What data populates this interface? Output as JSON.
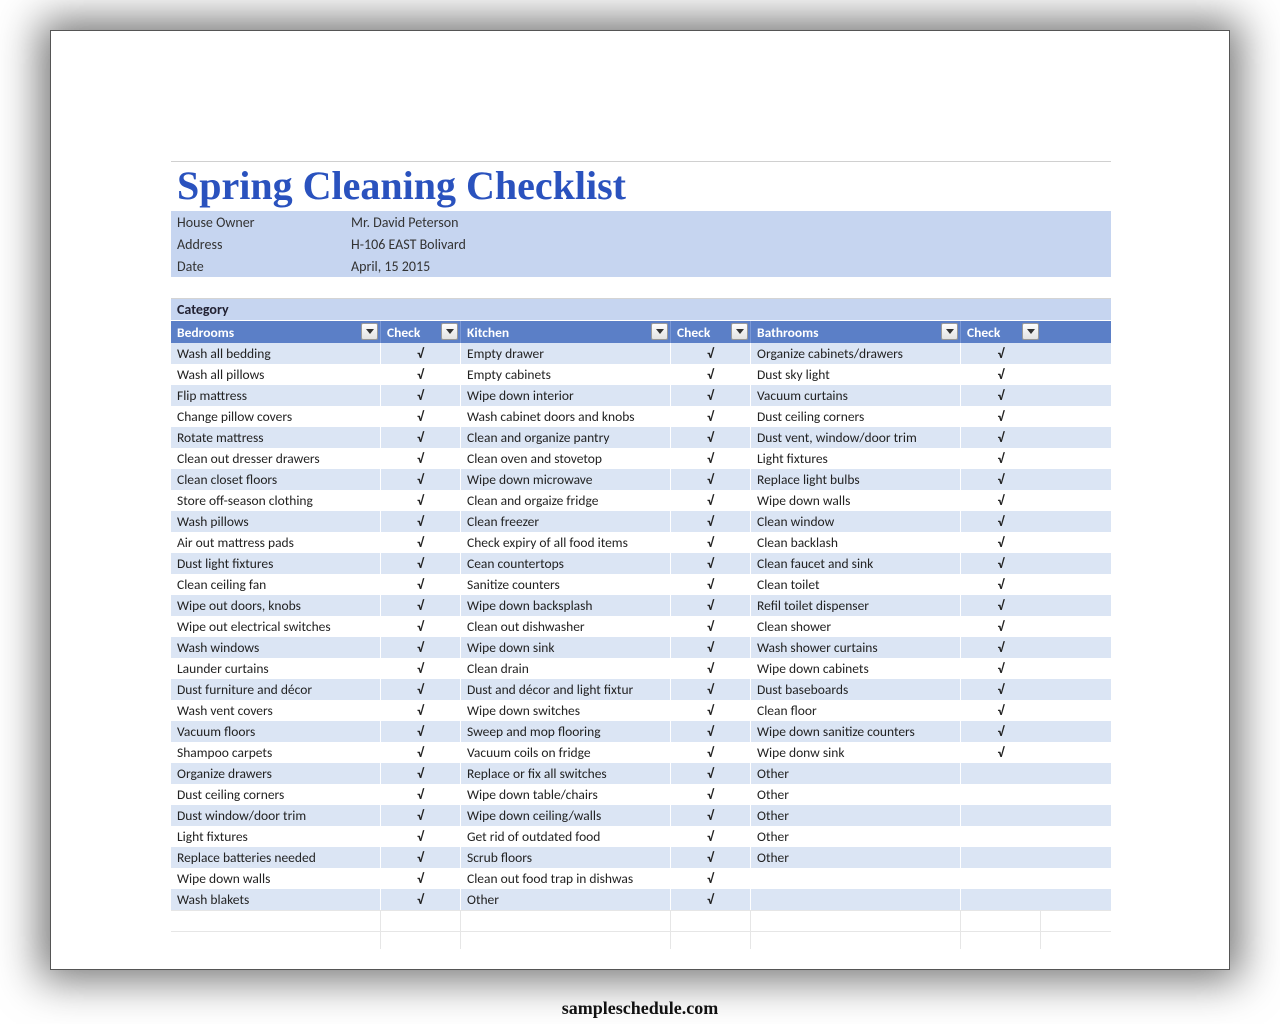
{
  "title": "Spring Cleaning Checklist",
  "info": {
    "owner_label": "House Owner",
    "owner_value": "Mr. David Peterson",
    "address_label": "Address",
    "address_value": "H-106 EAST Bolivard",
    "date_label": "Date",
    "date_value": "April, 15 2015"
  },
  "category_label": "Category",
  "headers": {
    "bedrooms": "Bedrooms",
    "check": "Check",
    "kitchen": "Kitchen",
    "bathrooms": "Bathrooms"
  },
  "check_mark": "√",
  "rows": [
    {
      "b": "Wash all bedding",
      "bc": true,
      "k": "Empty drawer",
      "kc": true,
      "t": "Organize cabinets/drawers",
      "tc": true
    },
    {
      "b": "Wash all pillows",
      "bc": true,
      "k": "Empty cabinets",
      "kc": true,
      "t": "Dust sky light",
      "tc": true
    },
    {
      "b": "Flip mattress",
      "bc": true,
      "k": "Wipe down interior",
      "kc": true,
      "t": "Vacuum curtains",
      "tc": true
    },
    {
      "b": "Change pillow covers",
      "bc": true,
      "k": "Wash cabinet doors and knobs",
      "kc": true,
      "t": "Dust ceiling corners",
      "tc": true
    },
    {
      "b": "Rotate mattress",
      "bc": true,
      "k": "Clean and organize pantry",
      "kc": true,
      "t": "Dust vent, window/door trim",
      "tc": true
    },
    {
      "b": "Clean out dresser drawers",
      "bc": true,
      "k": "Clean oven and stovetop",
      "kc": true,
      "t": "Light fixtures",
      "tc": true
    },
    {
      "b": "Clean closet floors",
      "bc": true,
      "k": "Wipe down microwave",
      "kc": true,
      "t": "Replace light bulbs",
      "tc": true
    },
    {
      "b": "Store off-season clothing",
      "bc": true,
      "k": "Clean and orgaize fridge",
      "kc": true,
      "t": "Wipe down walls",
      "tc": true
    },
    {
      "b": "Wash pillows",
      "bc": true,
      "k": "Clean freezer",
      "kc": true,
      "t": "Clean window",
      "tc": true
    },
    {
      "b": "Air out mattress pads",
      "bc": true,
      "k": "Check expiry of all food items",
      "kc": true,
      "t": "Clean backlash",
      "tc": true
    },
    {
      "b": "Dust light fixtures",
      "bc": true,
      "k": "Cean countertops",
      "kc": true,
      "t": "Clean faucet and sink",
      "tc": true
    },
    {
      "b": "Clean ceiling fan",
      "bc": true,
      "k": "Sanitize counters",
      "kc": true,
      "t": "Clean toilet",
      "tc": true
    },
    {
      "b": "Wipe out doors, knobs",
      "bc": true,
      "k": "Wipe down backsplash",
      "kc": true,
      "t": "Refil toilet dispenser",
      "tc": true
    },
    {
      "b": "Wipe out electrical switches",
      "bc": true,
      "k": "Clean out dishwasher",
      "kc": true,
      "t": "Clean shower",
      "tc": true
    },
    {
      "b": "Wash windows",
      "bc": true,
      "k": "Wipe down sink",
      "kc": true,
      "t": "Wash shower curtains",
      "tc": true
    },
    {
      "b": "Launder curtains",
      "bc": true,
      "k": "Clean drain",
      "kc": true,
      "t": "Wipe down cabinets",
      "tc": true
    },
    {
      "b": "Dust furniture and décor",
      "bc": true,
      "k": "Dust and décor and light fixtur",
      "kc": true,
      "t": "Dust baseboards",
      "tc": true
    },
    {
      "b": "Wash vent covers",
      "bc": true,
      "k": "Wipe down switches",
      "kc": true,
      "t": "Clean floor",
      "tc": true
    },
    {
      "b": "Vacuum floors",
      "bc": true,
      "k": "Sweep and mop flooring",
      "kc": true,
      "t": "Wipe down sanitize counters",
      "tc": true
    },
    {
      "b": "Shampoo carpets",
      "bc": true,
      "k": "Vacuum coils on fridge",
      "kc": true,
      "t": "Wipe donw sink",
      "tc": true
    },
    {
      "b": "Organize drawers",
      "bc": true,
      "k": "Replace or fix all switches",
      "kc": true,
      "t": "Other",
      "tc": false
    },
    {
      "b": "Dust ceiling corners",
      "bc": true,
      "k": "Wipe down table/chairs",
      "kc": true,
      "t": "Other",
      "tc": false
    },
    {
      "b": "Dust window/door trim",
      "bc": true,
      "k": "Wipe down ceiling/walls",
      "kc": true,
      "t": "Other",
      "tc": false
    },
    {
      "b": "Light fixtures",
      "bc": true,
      "k": "Get rid of outdated  food",
      "kc": true,
      "t": "Other",
      "tc": false
    },
    {
      "b": "Replace batteries needed",
      "bc": true,
      "k": "Scrub floors",
      "kc": true,
      "t": "Other",
      "tc": false
    },
    {
      "b": "Wipe down walls",
      "bc": true,
      "k": "Clean out food trap in dishwas",
      "kc": true,
      "t": "",
      "tc": false
    },
    {
      "b": "Wash blakets",
      "bc": true,
      "k": "Other",
      "kc": true,
      "t": "",
      "tc": false
    }
  ],
  "watermark": "sampleschedule.com"
}
